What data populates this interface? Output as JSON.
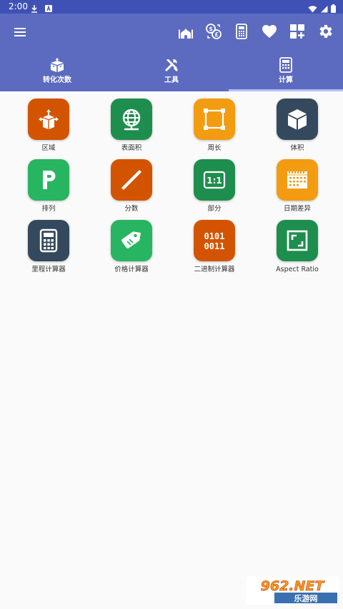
{
  "status": {
    "time": "2:00"
  },
  "colors": {
    "primary": "#5c6bc0",
    "status_bar": "#3f51b5",
    "orange_red": "#d35400",
    "green": "#1e8e4e",
    "light_green": "#27b561",
    "orange": "#f39c12",
    "navy": "#34495e"
  },
  "toolbar": {
    "icons": [
      "menu-icon",
      "mosque-icon",
      "currency-exchange-icon",
      "calculator-icon",
      "heart-icon",
      "add-widget-icon",
      "settings-icon"
    ]
  },
  "tabs": [
    {
      "label": "转化次数",
      "icon": "conversion-icon",
      "active": false
    },
    {
      "label": "工具",
      "icon": "tools-icon",
      "active": false
    },
    {
      "label": "计算",
      "icon": "calculator-icon",
      "active": true
    }
  ],
  "tiles": [
    {
      "label": "区域",
      "icon": "area-icon",
      "color": "#d35400"
    },
    {
      "label": "表面积",
      "icon": "globe-icon",
      "color": "#1e8e4e"
    },
    {
      "label": "周长",
      "icon": "perimeter-icon",
      "color": "#f39c12"
    },
    {
      "label": "体积",
      "icon": "cube-icon",
      "color": "#34495e"
    },
    {
      "label": "排列",
      "icon": "p-letter-icon",
      "color": "#27b561"
    },
    {
      "label": "分数",
      "icon": "slash-icon",
      "color": "#d35400"
    },
    {
      "label": "部分",
      "icon": "ratio-icon",
      "color": "#1e8e4e"
    },
    {
      "label": "日期差异",
      "icon": "calendar-icon",
      "color": "#f39c12"
    },
    {
      "label": "里程计算器",
      "icon": "calculator-icon",
      "color": "#34495e"
    },
    {
      "label": "价格计算器",
      "icon": "price-tag-icon",
      "color": "#27b561"
    },
    {
      "label": "二进制计算器",
      "icon": "binary-icon",
      "color": "#d35400"
    },
    {
      "label": "Aspect Ratio",
      "icon": "aspect-ratio-icon",
      "color": "#1e8e4e"
    }
  ],
  "watermark": {
    "text_top": "962.NET",
    "text_bottom": "乐游网"
  }
}
